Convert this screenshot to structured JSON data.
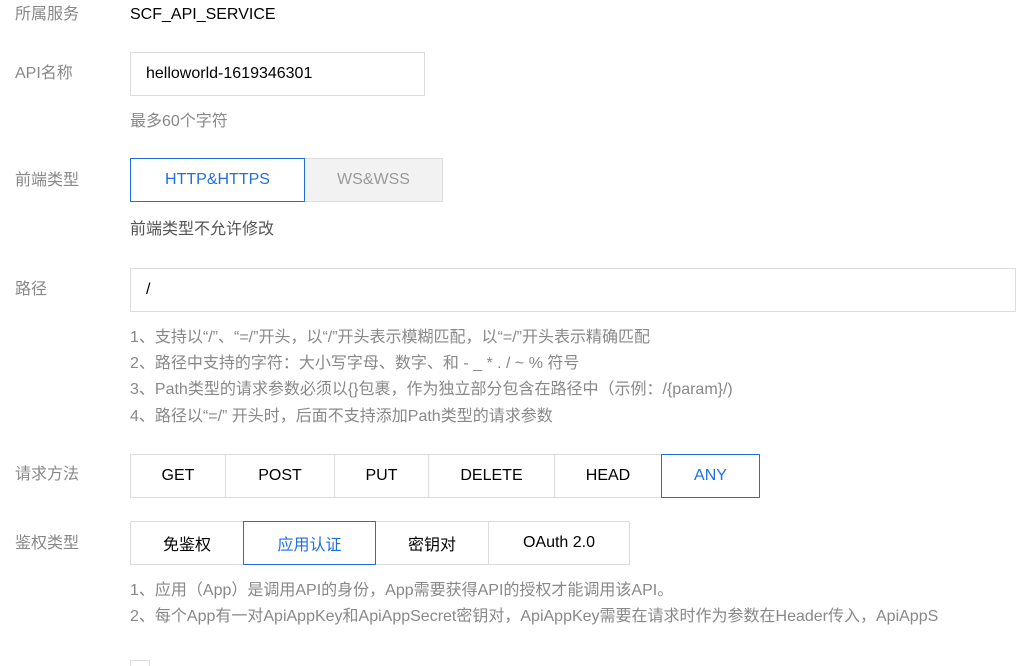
{
  "service": {
    "label": "所属服务",
    "value": "SCF_API_SERVICE"
  },
  "api_name": {
    "label": "API名称",
    "value": "helloworld-1619346301",
    "hint": "最多60个字符"
  },
  "frontend_type": {
    "label": "前端类型",
    "options": [
      "HTTP&HTTPS",
      "WS&WSS"
    ],
    "selected": "HTTP&HTTPS",
    "hint": "前端类型不允许修改"
  },
  "path": {
    "label": "路径",
    "value": "/",
    "hints": [
      "1、支持以“/”、“=/”开头，以“/”开头表示模糊匹配，以“=/”开头表示精确匹配",
      "2、路径中支持的字符：大小写字母、数字、和 - _ * . / ~ % 符号",
      "3、Path类型的请求参数必须以{}包裹，作为独立部分包含在路径中（示例：/{param}/)",
      "4、路径以“=/” 开头时，后面不支持添加Path类型的请求参数"
    ]
  },
  "method": {
    "label": "请求方法",
    "options": [
      "GET",
      "POST",
      "PUT",
      "DELETE",
      "HEAD",
      "ANY"
    ],
    "selected": "ANY"
  },
  "auth_type": {
    "label": "鉴权类型",
    "options": [
      "免鉴权",
      "应用认证",
      "密钥对",
      "OAuth 2.0"
    ],
    "selected": "应用认证",
    "hints": [
      "1、应用（App）是调用API的身份，App需要获得API的授权才能调用该API。",
      "2、每个App有一对ApiAppKey和ApiAppSecret密钥对，ApiAppKey需要在请求时作为参数在Header传入，ApiAppS"
    ]
  },
  "colors": {
    "accent": "#1f6fe0",
    "label": "#888888",
    "border": "#dcdcdc",
    "disabled_bg": "#f2f2f2"
  }
}
